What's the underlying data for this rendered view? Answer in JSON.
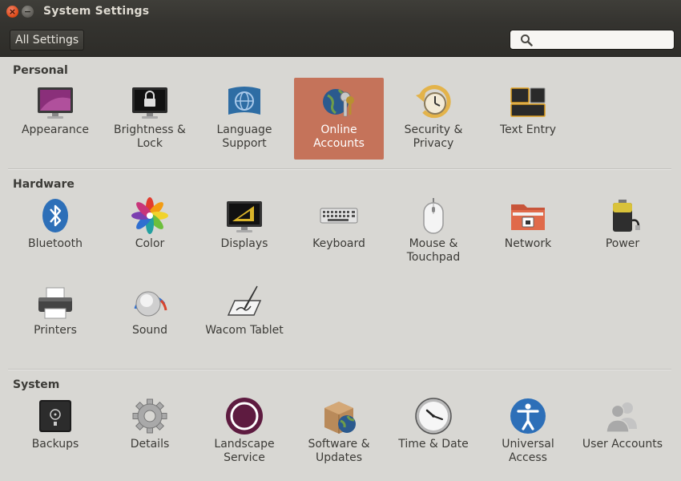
{
  "window": {
    "title": "System Settings"
  },
  "toolbar": {
    "all_settings_label": "All Settings",
    "search_placeholder": ""
  },
  "sections": {
    "personal": {
      "title": "Personal",
      "items": [
        {
          "label": "Appearance",
          "icon": "appearance-icon"
        },
        {
          "label": "Brightness &\nLock",
          "icon": "brightness-lock-icon"
        },
        {
          "label": "Language\nSupport",
          "icon": "language-support-icon"
        },
        {
          "label": "Online\nAccounts",
          "icon": "online-accounts-icon",
          "selected": true
        },
        {
          "label": "Security &\nPrivacy",
          "icon": "security-privacy-icon"
        },
        {
          "label": "Text Entry",
          "icon": "text-entry-icon"
        }
      ]
    },
    "hardware": {
      "title": "Hardware",
      "items": [
        {
          "label": "Bluetooth",
          "icon": "bluetooth-icon"
        },
        {
          "label": "Color",
          "icon": "color-icon"
        },
        {
          "label": "Displays",
          "icon": "displays-icon"
        },
        {
          "label": "Keyboard",
          "icon": "keyboard-icon"
        },
        {
          "label": "Mouse &\nTouchpad",
          "icon": "mouse-icon"
        },
        {
          "label": "Network",
          "icon": "network-icon"
        },
        {
          "label": "Power",
          "icon": "power-icon"
        },
        {
          "label": "Printers",
          "icon": "printer-icon"
        },
        {
          "label": "Sound",
          "icon": "sound-icon"
        },
        {
          "label": "Wacom Tablet",
          "icon": "wacom-tablet-icon"
        }
      ]
    },
    "system": {
      "title": "System",
      "items": [
        {
          "label": "Backups",
          "icon": "backups-icon"
        },
        {
          "label": "Details",
          "icon": "details-gear-icon"
        },
        {
          "label": "Landscape\nService",
          "icon": "landscape-icon"
        },
        {
          "label": "Software &\nUpdates",
          "icon": "software-updates-icon"
        },
        {
          "label": "Time & Date",
          "icon": "clock-icon"
        },
        {
          "label": "Universal\nAccess",
          "icon": "universal-access-icon"
        },
        {
          "label": "User Accounts",
          "icon": "user-accounts-icon"
        }
      ]
    }
  },
  "colors": {
    "selection": "#c5735a",
    "close_button": "#dd4814",
    "titlebar": "#3c3b37"
  }
}
